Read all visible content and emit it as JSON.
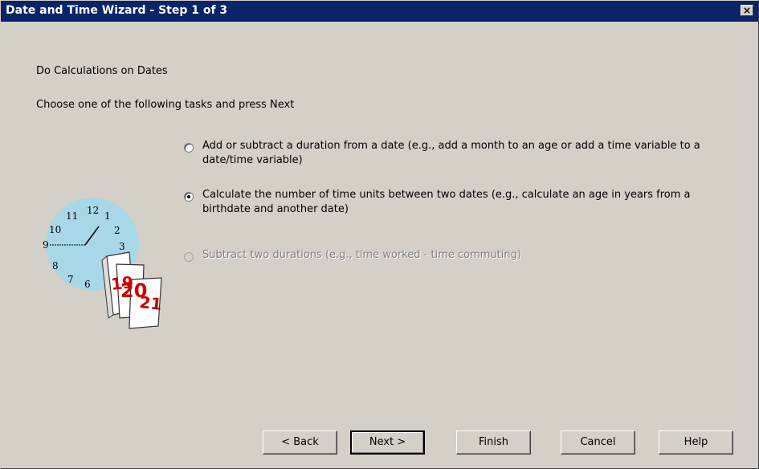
{
  "window": {
    "title": "Date and Time Wizard - Step 1 of 3",
    "close_glyph": "×"
  },
  "main": {
    "heading": "Do Calculations on Dates",
    "instruction": "Choose one of the following tasks and press Next",
    "options": [
      {
        "label": "Add or subtract a duration from a date (e.g., add a month to an age or add a time variable to a date/time variable)",
        "selected": false,
        "enabled": true
      },
      {
        "label": "Calculate the number of time units between two dates (e.g., calculate an age in years from a birthdate and another date)",
        "selected": true,
        "enabled": true
      },
      {
        "label": "Subtract two durations (e.g., time worked - time commuting)",
        "selected": false,
        "enabled": false
      }
    ],
    "illustration": {
      "clock_numbers": [
        "12",
        "1",
        "2",
        "3",
        "11",
        "10",
        "9",
        "8",
        "7",
        "6"
      ],
      "calendar_pages": [
        "19",
        "20",
        "21"
      ],
      "colors": {
        "clock_face": "#a8d8e8",
        "calendar_numbers": "#cc0000"
      }
    }
  },
  "buttons": {
    "back": "< Back",
    "next": "Next >",
    "finish": "Finish",
    "cancel": "Cancel",
    "help": "Help"
  },
  "colors": {
    "titlebar": "#0a246a",
    "face": "#d4d0c8"
  }
}
